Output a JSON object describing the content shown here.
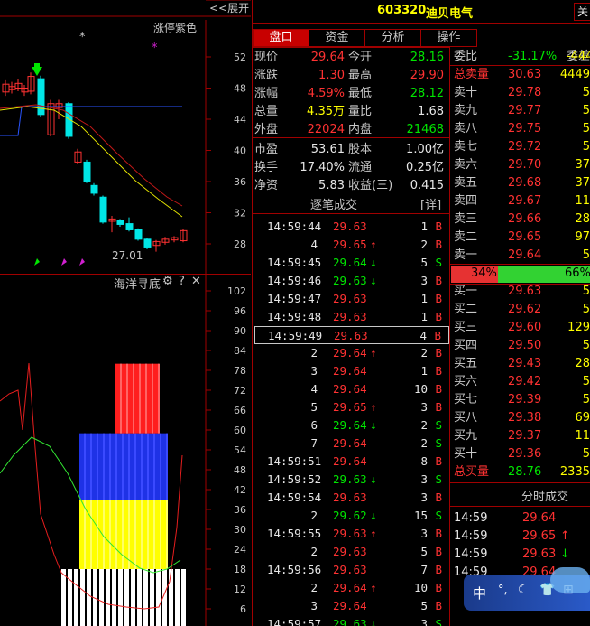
{
  "header": {
    "expand_label": "<<展开",
    "stock_code": "603320",
    "stock_name": "迪贝电气",
    "close_label": "关"
  },
  "kline": {
    "legend": "涨停紫色",
    "y_ticks": [
      "52",
      "48",
      "44",
      "40",
      "36",
      "32",
      "28"
    ],
    "low_label": "27.01",
    "marker_star": "*",
    "marker_star2": "*"
  },
  "indicator": {
    "title": "海洋寻底",
    "gear_icon": "gear",
    "help_label": "?",
    "close_label": "✕",
    "y_ticks": [
      "102",
      "96",
      "90",
      "84",
      "78",
      "72",
      "66",
      "60",
      "54",
      "48",
      "42",
      "36",
      "30",
      "24",
      "18",
      "12",
      "6"
    ]
  },
  "tabs": [
    "盘口",
    "资金",
    "分析",
    "操作"
  ],
  "quote": {
    "rows": [
      {
        "l1": "现价",
        "v1": "29.64",
        "c1": "red",
        "l2": "今开",
        "v2": "28.16",
        "c2": "green"
      },
      {
        "l1": "涨跌",
        "v1": "1.30",
        "c1": "red",
        "l2": "最高",
        "v2": "29.90",
        "c2": "red"
      },
      {
        "l1": "涨幅",
        "v1": "4.59%",
        "c1": "red",
        "l2": "最低",
        "v2": "28.12",
        "c2": "green"
      },
      {
        "l1": "总量",
        "v1": "4.35万",
        "c1": "yellow",
        "l2": "量比",
        "v2": "1.68",
        "c2": "white"
      },
      {
        "l1": "外盘",
        "v1": "22024",
        "c1": "red",
        "l2": "内盘",
        "v2": "21468",
        "c2": "green"
      },
      {
        "l1": "市盈",
        "v1": "53.61",
        "c1": "white",
        "l2": "股本",
        "v2": "1.00亿",
        "c2": "white"
      },
      {
        "l1": "换手",
        "v1": "17.40%",
        "c1": "white",
        "l2": "流通",
        "v2": "0.25亿",
        "c2": "white"
      },
      {
        "l1": "净资",
        "v1": "5.83",
        "c1": "white",
        "l2": "收益(三)",
        "v2": "0.415",
        "c2": "white"
      }
    ]
  },
  "trades": {
    "title": "逐笔成交",
    "detail_label": "[详]",
    "rows": [
      {
        "time": "14:59:44",
        "price": "29.63",
        "arrow": "",
        "vol": "1",
        "side": "B"
      },
      {
        "time": "4",
        "price": "29.65",
        "arrow": "up",
        "vol": "2",
        "side": "B"
      },
      {
        "time": "14:59:45",
        "price": "29.64",
        "arrow": "down",
        "vol": "5",
        "side": "S"
      },
      {
        "time": "14:59:46",
        "price": "29.63",
        "arrow": "down",
        "vol": "3",
        "side": "B"
      },
      {
        "time": "14:59:47",
        "price": "29.63",
        "arrow": "",
        "vol": "1",
        "side": "B"
      },
      {
        "time": "14:59:48",
        "price": "29.63",
        "arrow": "",
        "vol": "1",
        "side": "B"
      },
      {
        "time": "14:59:49",
        "price": "29.63",
        "arrow": "",
        "vol": "4",
        "side": "B"
      },
      {
        "time": "2",
        "price": "29.64",
        "arrow": "up",
        "vol": "2",
        "side": "B"
      },
      {
        "time": "3",
        "price": "29.64",
        "arrow": "",
        "vol": "1",
        "side": "B"
      },
      {
        "time": "4",
        "price": "29.64",
        "arrow": "",
        "vol": "10",
        "side": "B"
      },
      {
        "time": "5",
        "price": "29.65",
        "arrow": "up",
        "vol": "3",
        "side": "B"
      },
      {
        "time": "6",
        "price": "29.64",
        "arrow": "down",
        "vol": "2",
        "side": "S"
      },
      {
        "time": "7",
        "price": "29.64",
        "arrow": "",
        "vol": "2",
        "side": "S"
      },
      {
        "time": "14:59:51",
        "price": "29.64",
        "arrow": "",
        "vol": "8",
        "side": "B"
      },
      {
        "time": "14:59:52",
        "price": "29.63",
        "arrow": "down",
        "vol": "3",
        "side": "S"
      },
      {
        "time": "14:59:54",
        "price": "29.63",
        "arrow": "",
        "vol": "3",
        "side": "B"
      },
      {
        "time": "2",
        "price": "29.62",
        "arrow": "down",
        "vol": "15",
        "side": "S"
      },
      {
        "time": "14:59:55",
        "price": "29.63",
        "arrow": "up",
        "vol": "3",
        "side": "B"
      },
      {
        "time": "2",
        "price": "29.63",
        "arrow": "",
        "vol": "5",
        "side": "B"
      },
      {
        "time": "14:59:56",
        "price": "29.63",
        "arrow": "",
        "vol": "7",
        "side": "B"
      },
      {
        "time": "2",
        "price": "29.64",
        "arrow": "up",
        "vol": "10",
        "side": "B"
      },
      {
        "time": "3",
        "price": "29.64",
        "arrow": "",
        "vol": "5",
        "side": "B"
      },
      {
        "time": "14:59:57",
        "price": "29.63",
        "arrow": "down",
        "vol": "3",
        "side": "S"
      }
    ]
  },
  "orderbook": {
    "weibi_label": "委比",
    "weibi_value": "-31.17%",
    "weicha_label": "委差",
    "weicha_value": "-4449",
    "total_sell_label": "总卖量",
    "total_sell_price": "30.63",
    "total_sell_vol": "4449",
    "asks": [
      {
        "label": "卖十",
        "price": "29.78",
        "vol": "5"
      },
      {
        "label": "卖九",
        "price": "29.77",
        "vol": "5"
      },
      {
        "label": "卖八",
        "price": "29.75",
        "vol": "5"
      },
      {
        "label": "卖七",
        "price": "29.72",
        "vol": "5"
      },
      {
        "label": "卖六",
        "price": "29.70",
        "vol": "37"
      },
      {
        "label": "卖五",
        "price": "29.68",
        "vol": "37"
      },
      {
        "label": "卖四",
        "price": "29.67",
        "vol": "11"
      },
      {
        "label": "卖三",
        "price": "29.66",
        "vol": "28"
      },
      {
        "label": "卖二",
        "price": "29.65",
        "vol": "97"
      },
      {
        "label": "卖一",
        "price": "29.64",
        "vol": "5"
      }
    ],
    "ratio_sell": "34%",
    "ratio_buy": "66%",
    "ratio_sell_frac": 0.34,
    "bids": [
      {
        "label": "买一",
        "price": "29.63",
        "vol": "5"
      },
      {
        "label": "买二",
        "price": "29.62",
        "vol": "5"
      },
      {
        "label": "买三",
        "price": "29.60",
        "vol": "129"
      },
      {
        "label": "买四",
        "price": "29.50",
        "vol": "5"
      },
      {
        "label": "买五",
        "price": "29.43",
        "vol": "28"
      },
      {
        "label": "买六",
        "price": "29.42",
        "vol": "5"
      },
      {
        "label": "买七",
        "price": "29.39",
        "vol": "5"
      },
      {
        "label": "买八",
        "price": "29.38",
        "vol": "69"
      },
      {
        "label": "买九",
        "price": "29.37",
        "vol": "11"
      },
      {
        "label": "买十",
        "price": "29.36",
        "vol": "5"
      }
    ],
    "total_buy_label": "总买量",
    "total_buy_price": "28.76",
    "total_buy_vol": "2335"
  },
  "minute_trades": {
    "title": "分时成交",
    "rows": [
      {
        "time": "14:59",
        "price": "29.64",
        "arrow": ""
      },
      {
        "time": "14:59",
        "price": "29.65",
        "arrow": "up"
      },
      {
        "time": "14:59",
        "price": "29.63",
        "arrow": "down"
      },
      {
        "time": "14:59",
        "price": "29.64",
        "arrow": ""
      }
    ]
  },
  "ime": {
    "label": "中",
    "icons": [
      "punct-icon",
      "moon-icon",
      "shirt-icon",
      "grid-icon"
    ]
  },
  "colors": {
    "up": "#ff3232",
    "down": "#00e600",
    "border": "#a00000",
    "tab_active": "#c80000"
  }
}
